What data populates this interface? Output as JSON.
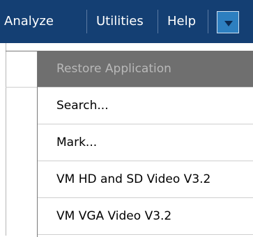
{
  "menubar": {
    "items": [
      {
        "label": "Analyze"
      },
      {
        "label": "Utilities"
      },
      {
        "label": "Help"
      }
    ],
    "dropdown_icon": "chevron-down-icon",
    "colors": {
      "bar_bg": "#143f73",
      "text": "#ffffff",
      "button_bg": "#2d7fc0"
    }
  },
  "dropdown_menu": {
    "items": [
      {
        "label": "Restore Application",
        "enabled": false
      },
      {
        "label": "Search...",
        "enabled": true
      },
      {
        "label": "Mark...",
        "enabled": true
      },
      {
        "label": "VM HD and SD Video V3.2",
        "enabled": true
      },
      {
        "label": "VM VGA Video V3.2",
        "enabled": true
      }
    ]
  }
}
